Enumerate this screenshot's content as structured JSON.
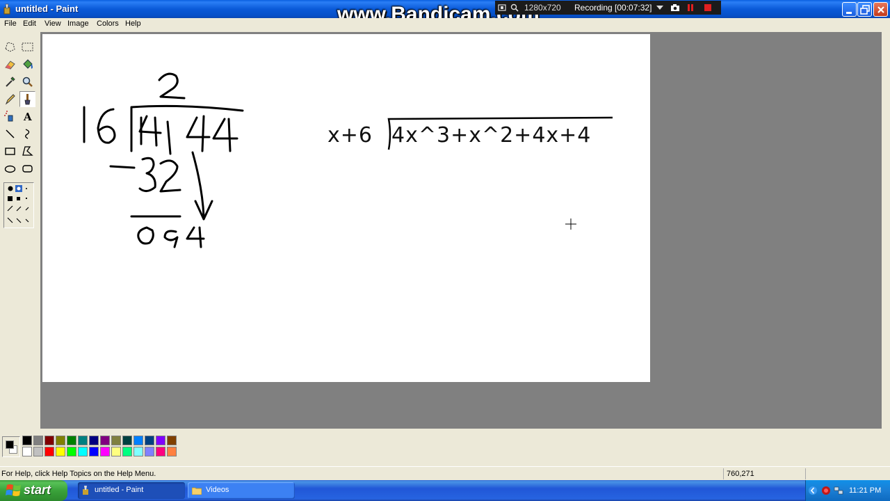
{
  "window": {
    "title": "untitled - Paint"
  },
  "recorder": {
    "watermark": "www.Bandicam.com",
    "size": "1280x720",
    "status": "Recording [00:07:32]"
  },
  "menu": [
    "File",
    "Edit",
    "View",
    "Image",
    "Colors",
    "Help"
  ],
  "tools": [
    "free-form-select",
    "select",
    "eraser",
    "fill-with-color",
    "pick-color",
    "magnifier",
    "pencil",
    "brush",
    "airbrush",
    "text",
    "line",
    "curve",
    "rectangle",
    "polygon",
    "ellipse",
    "rounded-rectangle"
  ],
  "active_tool": "brush",
  "canvas": {
    "typed_expression": {
      "divisor": "x+6",
      "dividend": "4x^3+x^2+4x+4"
    },
    "handwritten": {
      "divisor": "16",
      "quotient": "2",
      "dividend": "144",
      "subtracted": "-32",
      "remainder_row": "094"
    }
  },
  "palette": {
    "foreground": "#000000",
    "background": "#ffffff",
    "colors_top": [
      "#000000",
      "#808080",
      "#800000",
      "#808000",
      "#008000",
      "#008080",
      "#000080",
      "#800080",
      "#808040",
      "#004040",
      "#0080ff",
      "#004080",
      "#8000ff",
      "#804000"
    ],
    "colors_bottom": [
      "#ffffff",
      "#c0c0c0",
      "#ff0000",
      "#ffff00",
      "#00ff00",
      "#00ffff",
      "#0000ff",
      "#ff00ff",
      "#ffff80",
      "#00ff80",
      "#80ffff",
      "#8080ff",
      "#ff0080",
      "#ff8040"
    ]
  },
  "status": {
    "help": "For Help, click Help Topics on the Help Menu.",
    "coords": "760,271"
  },
  "taskbar": {
    "start": "start",
    "items": [
      {
        "label": "untitled - Paint",
        "active": true
      },
      {
        "label": "Videos",
        "active": false
      }
    ],
    "clock": "11:21 PM"
  }
}
